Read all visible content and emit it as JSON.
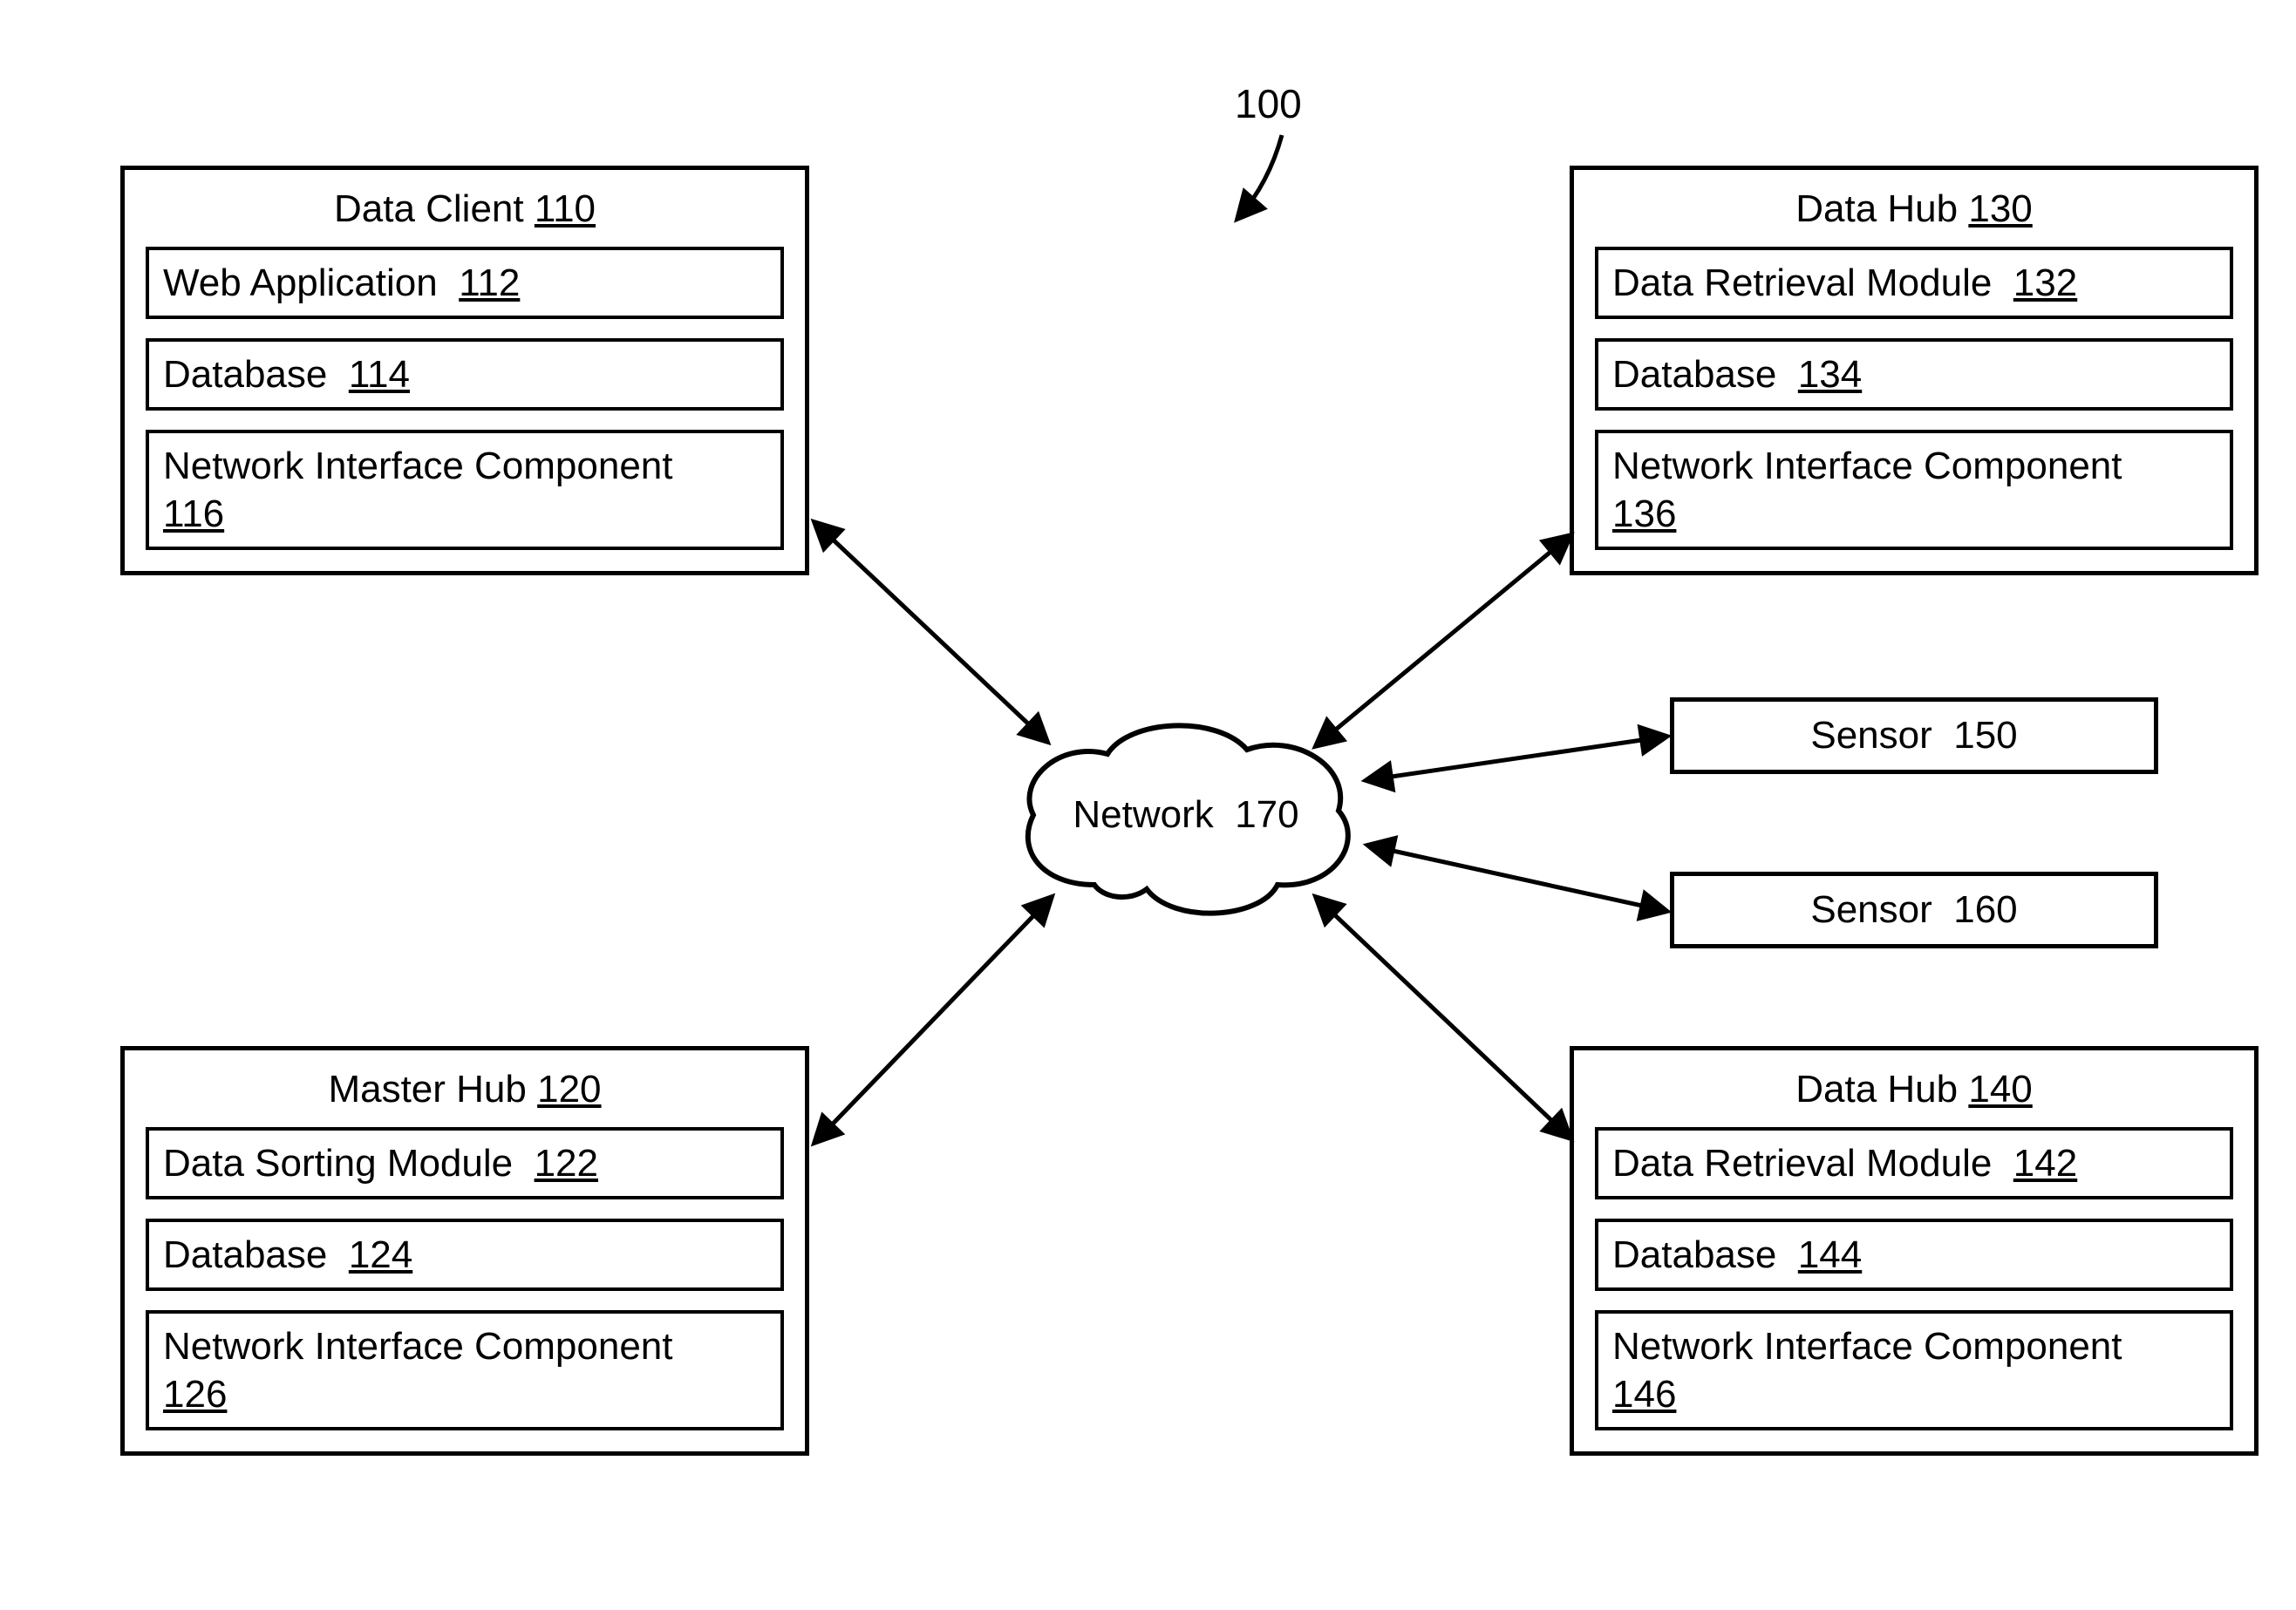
{
  "figure": {
    "ref": "100"
  },
  "network": {
    "label": "Network",
    "ref": "170"
  },
  "dataClient": {
    "title": "Data Client",
    "ref": "110",
    "items": [
      {
        "label": "Web Application",
        "ref": "112"
      },
      {
        "label": "Database",
        "ref": "114"
      },
      {
        "label": "Network Interface Component",
        "ref": "116"
      }
    ]
  },
  "masterHub": {
    "title": "Master Hub",
    "ref": "120",
    "items": [
      {
        "label": "Data Sorting Module",
        "ref": "122"
      },
      {
        "label": "Database",
        "ref": "124"
      },
      {
        "label": "Network Interface Component",
        "ref": "126"
      }
    ]
  },
  "dataHub1": {
    "title": "Data Hub",
    "ref": "130",
    "items": [
      {
        "label": "Data Retrieval Module",
        "ref": "132"
      },
      {
        "label": "Database",
        "ref": "134"
      },
      {
        "label": "Network Interface Component",
        "ref": "136"
      }
    ]
  },
  "dataHub2": {
    "title": "Data Hub",
    "ref": "140",
    "items": [
      {
        "label": "Data Retrieval Module",
        "ref": "142"
      },
      {
        "label": "Database",
        "ref": "144"
      },
      {
        "label": "Network Interface Component",
        "ref": "146"
      }
    ]
  },
  "sensor1": {
    "label": "Sensor",
    "ref": "150"
  },
  "sensor2": {
    "label": "Sensor",
    "ref": "160"
  }
}
